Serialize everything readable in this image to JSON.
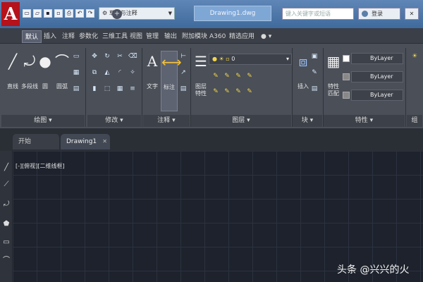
{
  "titlebar": {
    "app_logo": "A",
    "workspace": "草图与注释",
    "document_title": "Drawing1.dwg",
    "search_placeholder": "键入关键字或短语",
    "login_label": "登录"
  },
  "ribbon_tabs": [
    {
      "label": "默认",
      "active": true
    },
    {
      "label": "插入"
    },
    {
      "label": "注释"
    },
    {
      "label": "参数化"
    },
    {
      "label": "三维工具"
    },
    {
      "label": "视图"
    },
    {
      "label": "管理"
    },
    {
      "label": "输出"
    },
    {
      "label": "附加模块"
    },
    {
      "label": "A360"
    },
    {
      "label": "精选应用"
    }
  ],
  "draw_panel": {
    "tools": [
      "直线",
      "多段线",
      "圆",
      "圆弧"
    ],
    "title": "绘图"
  },
  "modify_panel": {
    "title": "修改"
  },
  "annotation_panel": {
    "tools": [
      "文字",
      "标注"
    ],
    "title": "注释"
  },
  "layers_panel": {
    "tools": [
      "图层",
      "特性"
    ],
    "layer_value": "0",
    "title": "图层"
  },
  "block_panel": {
    "tools": [
      "插入"
    ],
    "title": "块"
  },
  "properties_panel": {
    "tools": [
      "特性",
      "匹配"
    ],
    "color": "ByLayer",
    "linetype": "ByLayer",
    "lineweight": "ByLayer",
    "title": "特性"
  },
  "group_panel": {
    "title": "组"
  },
  "doc_tabs": [
    {
      "label": "开始"
    },
    {
      "label": "Drawing1",
      "active": true
    }
  ],
  "canvas": {
    "viewport_label": "[-][俯视][二维线框]"
  },
  "watermark": "头条 @兴兴的火"
}
